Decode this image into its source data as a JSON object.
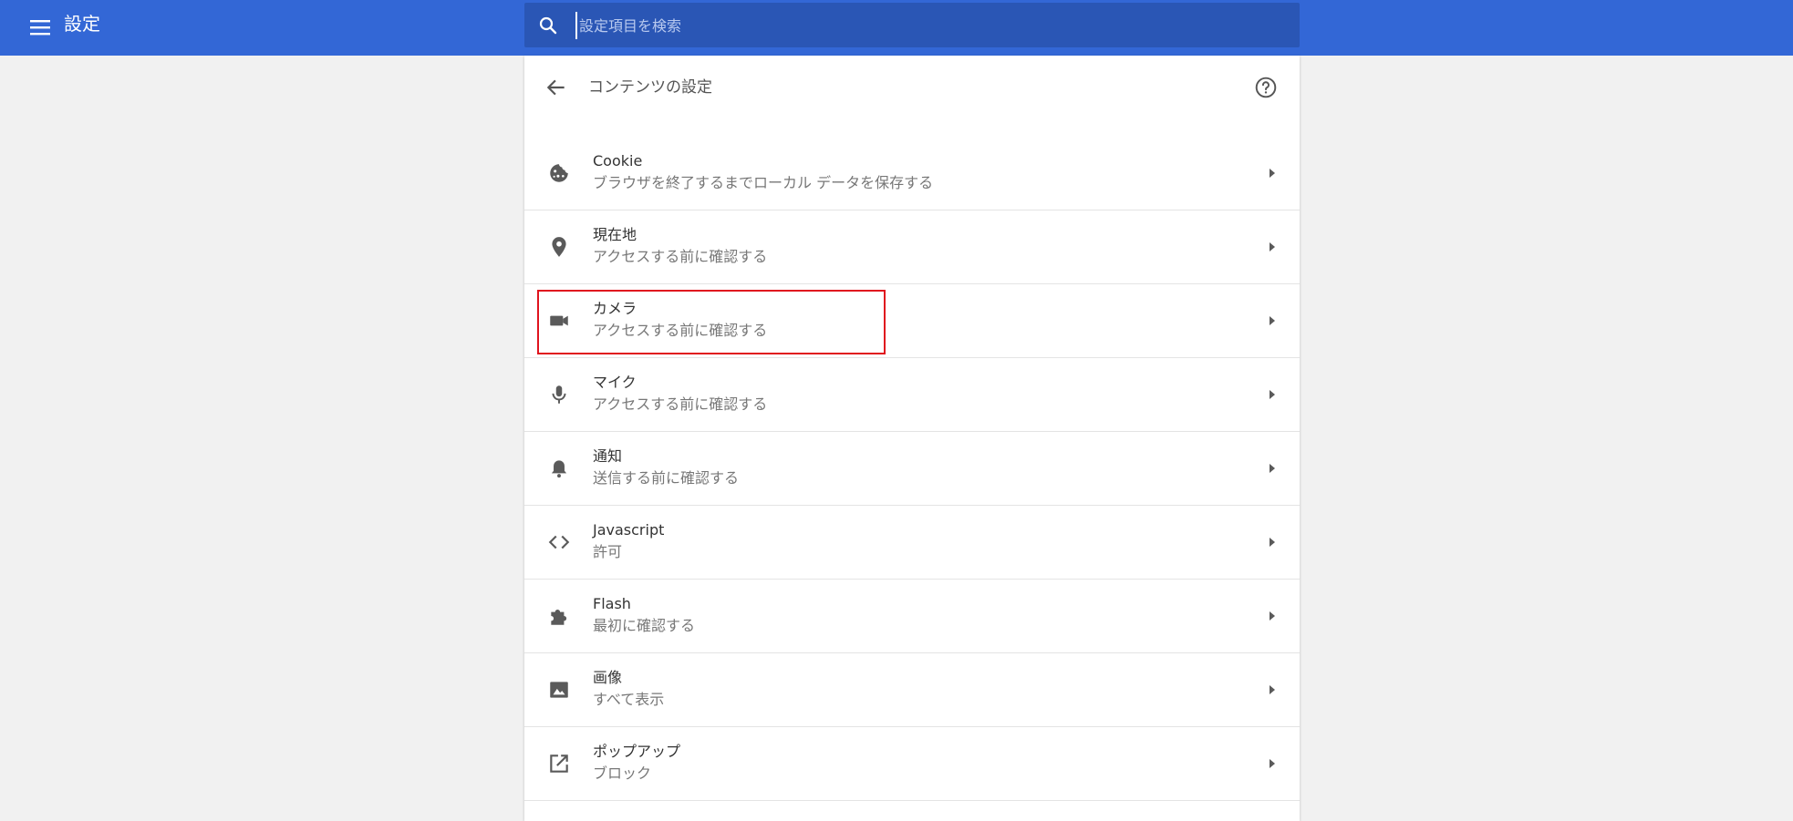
{
  "header": {
    "title": "設定",
    "menu_icon": "hamburger-menu-icon",
    "search": {
      "placeholder": "設定項目を検索",
      "value": ""
    }
  },
  "page": {
    "title": "コンテンツの設定",
    "back_icon": "arrow-back-icon",
    "help_icon": "help-icon"
  },
  "settings": [
    {
      "label": "Cookie",
      "sub": "ブラウザを終了するまでローカル データを保存する",
      "icon": "cookie-icon"
    },
    {
      "label": "現在地",
      "sub": "アクセスする前に確認する",
      "icon": "location-pin-icon"
    },
    {
      "label": "カメラ",
      "sub": "アクセスする前に確認する",
      "icon": "camera-icon"
    },
    {
      "label": "マイク",
      "sub": "アクセスする前に確認する",
      "icon": "microphone-icon"
    },
    {
      "label": "通知",
      "sub": "送信する前に確認する",
      "icon": "bell-icon"
    },
    {
      "label": "Javascript",
      "sub": "許可",
      "icon": "code-icon"
    },
    {
      "label": "Flash",
      "sub": "最初に確認する",
      "icon": "puzzle-icon"
    },
    {
      "label": "画像",
      "sub": "すべて表示",
      "icon": "image-icon"
    },
    {
      "label": "ポップアップ",
      "sub": "ブロック",
      "icon": "open-in-new-icon"
    }
  ],
  "colors": {
    "header_bg": "#3367d6",
    "search_bg": "#2a56b5",
    "highlight": "#e0141e",
    "icon": "#5a5a5a"
  }
}
